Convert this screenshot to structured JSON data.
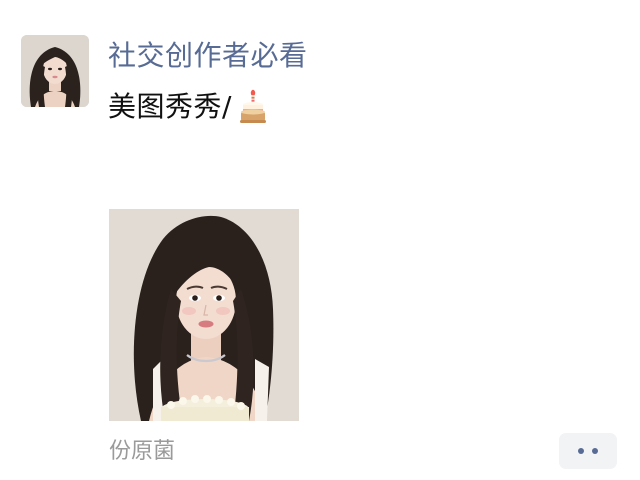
{
  "post": {
    "author": "社交创作者必看",
    "text": "美图秀秀/",
    "emoji": "cake-icon",
    "location": "份原菌",
    "photo_subject": "woman-portrait",
    "more_button": "more-options-icon"
  },
  "colors": {
    "author_link": "#576b95",
    "body_text": "#111111",
    "location_text": "#9a9a9a",
    "button_bg": "#f2f3f5",
    "background": "#ffffff"
  }
}
